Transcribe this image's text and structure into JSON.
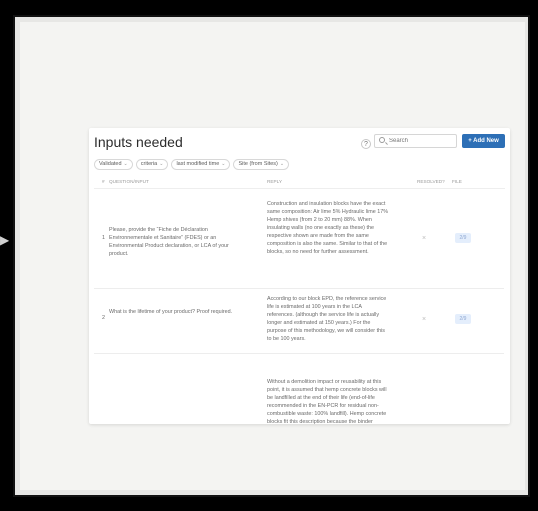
{
  "title": "Inputs needed",
  "help_glyph": "?",
  "search_placeholder": "Search",
  "add_new_label": "+ Add New",
  "filters": [
    "Validated",
    "criteria",
    "last modified time",
    "Site (from Sites)"
  ],
  "columns": [
    "#",
    "QUESTION/INPUT",
    "REPLY",
    "RESOLVED?",
    "FILE"
  ],
  "rows": [
    {
      "number": "1",
      "question": "Please, provide the “Fiche de Déclaration Environnementale et Sanitaire” (FDES) or an Environmental Product declaration, or LCA of your product.",
      "reply": "Construction and insulation blocks have the exact same composition: Air lime 5% Hydraulic lime 17% Hemp shives (from 2 to 20 mm) 88%. When insulating walls (no one exactly as these) the respective shown are made from the same composition is also the same. Similar to that of the blocks, so no need for further assessment.",
      "resolved": "×",
      "file": "2/9"
    },
    {
      "number": "2",
      "question": "What is the lifetime of your product? Proof required.",
      "reply": "According to our block EPD, the reference service life is estimated at 100 years in the LCA references. (although the service life is actually longer and estimated at 150 years.) For the purpose of this methodology, we will consider this to be 100 years.",
      "resolved": "×",
      "file": "2/9"
    },
    {
      "number": "",
      "question": "",
      "reply": "Without a demolition impact or reusability at this point, it is assumed that hemp concrete blocks will be landfilled at the end of their life (end-of-life recommended in the EN-PCR for residual non-combustible waste: 100% landfill). Hemp concrete blocks fit this description because the binder content and the limestone derivatives, is not suitable for incineration.",
      "resolved": "",
      "file": ""
    }
  ],
  "icons": {
    "arrow": "arrow-right-icon",
    "search": "search-icon",
    "chevron": "chevron-down-icon",
    "help": "help-icon",
    "close": "close-icon"
  },
  "colors": {
    "accent": "#2d6fb6",
    "page_background": "#e7e7e5",
    "card_background": "#ffffff",
    "status_pill_background": "#e4eefc"
  }
}
